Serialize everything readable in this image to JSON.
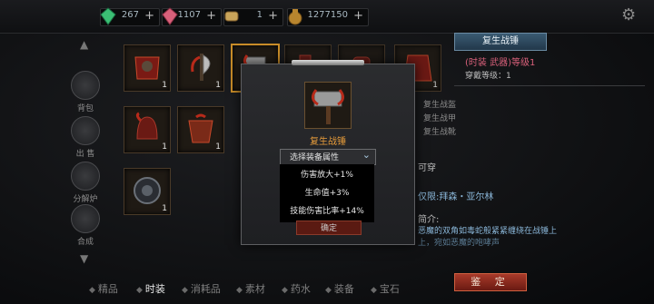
{
  "currencies": [
    {
      "icon": "green-gem-icon",
      "value": "267",
      "color": "#3bbf74"
    },
    {
      "icon": "pink-gem-icon",
      "value": "1107",
      "color": "#d8607a"
    },
    {
      "icon": "scroll-icon",
      "value": "1",
      "color": "#c9a45a"
    },
    {
      "icon": "gold-bag-icon",
      "value": "1277150",
      "color": "#b8852e"
    }
  ],
  "sidebar": {
    "items": [
      {
        "icon": "backpack-icon",
        "label": "背包"
      },
      {
        "icon": "sell-bag-icon",
        "label": "出 售"
      },
      {
        "icon": "decompose-icon",
        "label": "分解炉"
      },
      {
        "icon": "synthesis-icon",
        "label": "合成"
      }
    ]
  },
  "grid": {
    "slots": [
      {
        "count": "1",
        "selected": false
      },
      {
        "count": "1",
        "selected": false
      },
      {
        "count": "1",
        "selected": true
      },
      {
        "count": "",
        "selected": false
      },
      {
        "count": "",
        "selected": false
      },
      {
        "count": "1",
        "selected": false
      },
      {
        "count": "1",
        "selected": false
      },
      {
        "count": "1",
        "selected": false
      },
      {
        "count": "1",
        "selected": false
      }
    ]
  },
  "detail": {
    "name": "复生战锤",
    "type_line": "(时装 武器)等级1",
    "wear_level": "穿戴等级：1",
    "set_items": [
      "复生战盔",
      "复生战甲",
      "复生战靴"
    ],
    "wearable": "可穿",
    "class_line": "仅限:拜森・亚尔林",
    "intro_label": "简介:",
    "intro_text": "恶魔的双角如毒蛇般紧紧缠绕在战锤上",
    "intro_text2": "上，宛如恶魔的咆哮声"
  },
  "confirm_label": "鉴 定",
  "tabs": [
    {
      "label": "精品",
      "active": false
    },
    {
      "label": "时装",
      "active": true
    },
    {
      "label": "消耗品",
      "active": false
    },
    {
      "label": "素材",
      "active": false
    },
    {
      "label": "药水",
      "active": false
    },
    {
      "label": "装备",
      "active": false
    },
    {
      "label": "宝石",
      "active": false
    }
  ],
  "modal": {
    "item_name": "复生战锤",
    "select_label": "选择装备属性",
    "options": [
      "伤害放大+1%",
      "生命值+3%",
      "技能伤害比率+14%"
    ],
    "button_label": "确定"
  }
}
